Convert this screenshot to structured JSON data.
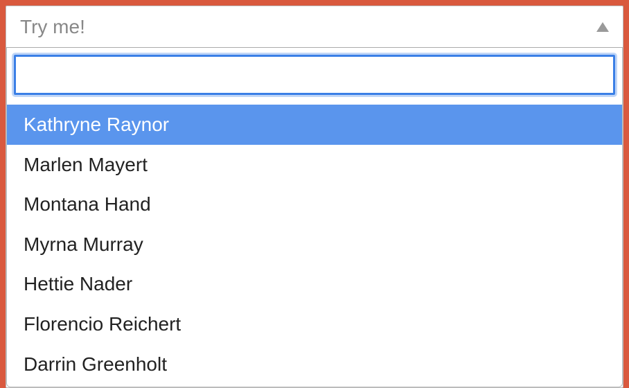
{
  "select": {
    "placeholder": "Try me!",
    "search_value": "",
    "highlighted_index": 0,
    "options": [
      "Kathryne Raynor",
      "Marlen Mayert",
      "Montana Hand",
      "Myrna Murray",
      "Hettie Nader",
      "Florencio Reichert",
      "Darrin Greenholt"
    ]
  },
  "colors": {
    "background": "#d9593e",
    "highlight": "#5a95ed",
    "focus_ring": "#3a7fe6"
  }
}
